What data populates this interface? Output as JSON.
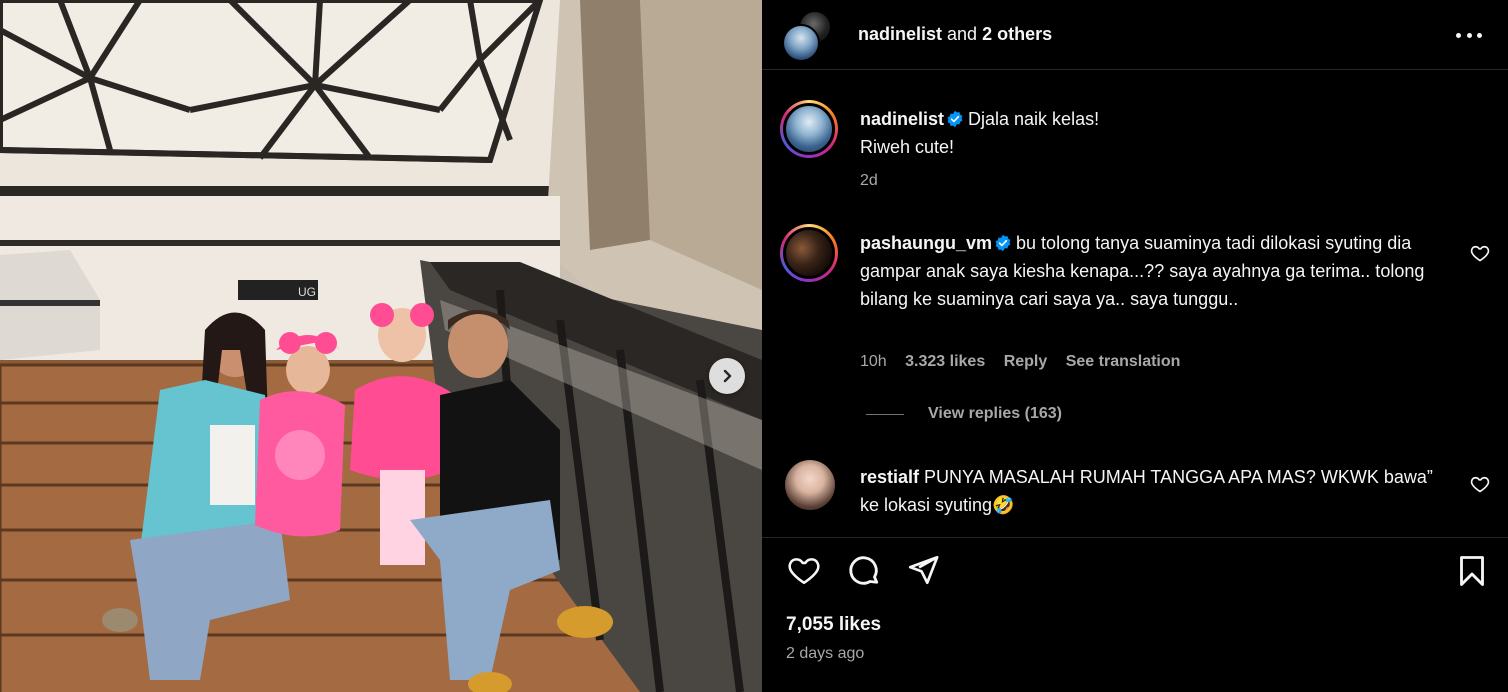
{
  "header": {
    "username": "nadinelist",
    "connector": "and",
    "others": "2 others",
    "more_icon": "more-horizontal-icon"
  },
  "caption": {
    "username": "nadinelist",
    "line1": "Djala naik kelas!",
    "line2": "Riweh cute!",
    "time": "2d"
  },
  "comments": [
    {
      "username": "pashaungu_vm",
      "verified": true,
      "text": "bu tolong tanya suaminya tadi dilokasi syuting dia gampar anak saya kiesha kenapa...?? saya ayahnya ga terima.. tolong bilang ke suaminya cari saya ya.. saya tunggu..",
      "time": "10h",
      "likes": "3.323 likes",
      "reply": "Reply",
      "translation": "See translation",
      "view_replies": "View replies (163)"
    },
    {
      "username": "restialf",
      "verified": false,
      "text": "PUNYA MASALAH RUMAH TANGGA APA MAS? WKWK bawa” ke lokasi syuting🤣"
    }
  ],
  "footer": {
    "likes": "7,055 likes",
    "time_ago": "2 days ago"
  },
  "photo": {
    "sign_text": "UG"
  },
  "colors": {
    "background": "#000000",
    "text": "#f5f5f5",
    "muted": "#a8a8a8",
    "verified": "#0095f6"
  }
}
